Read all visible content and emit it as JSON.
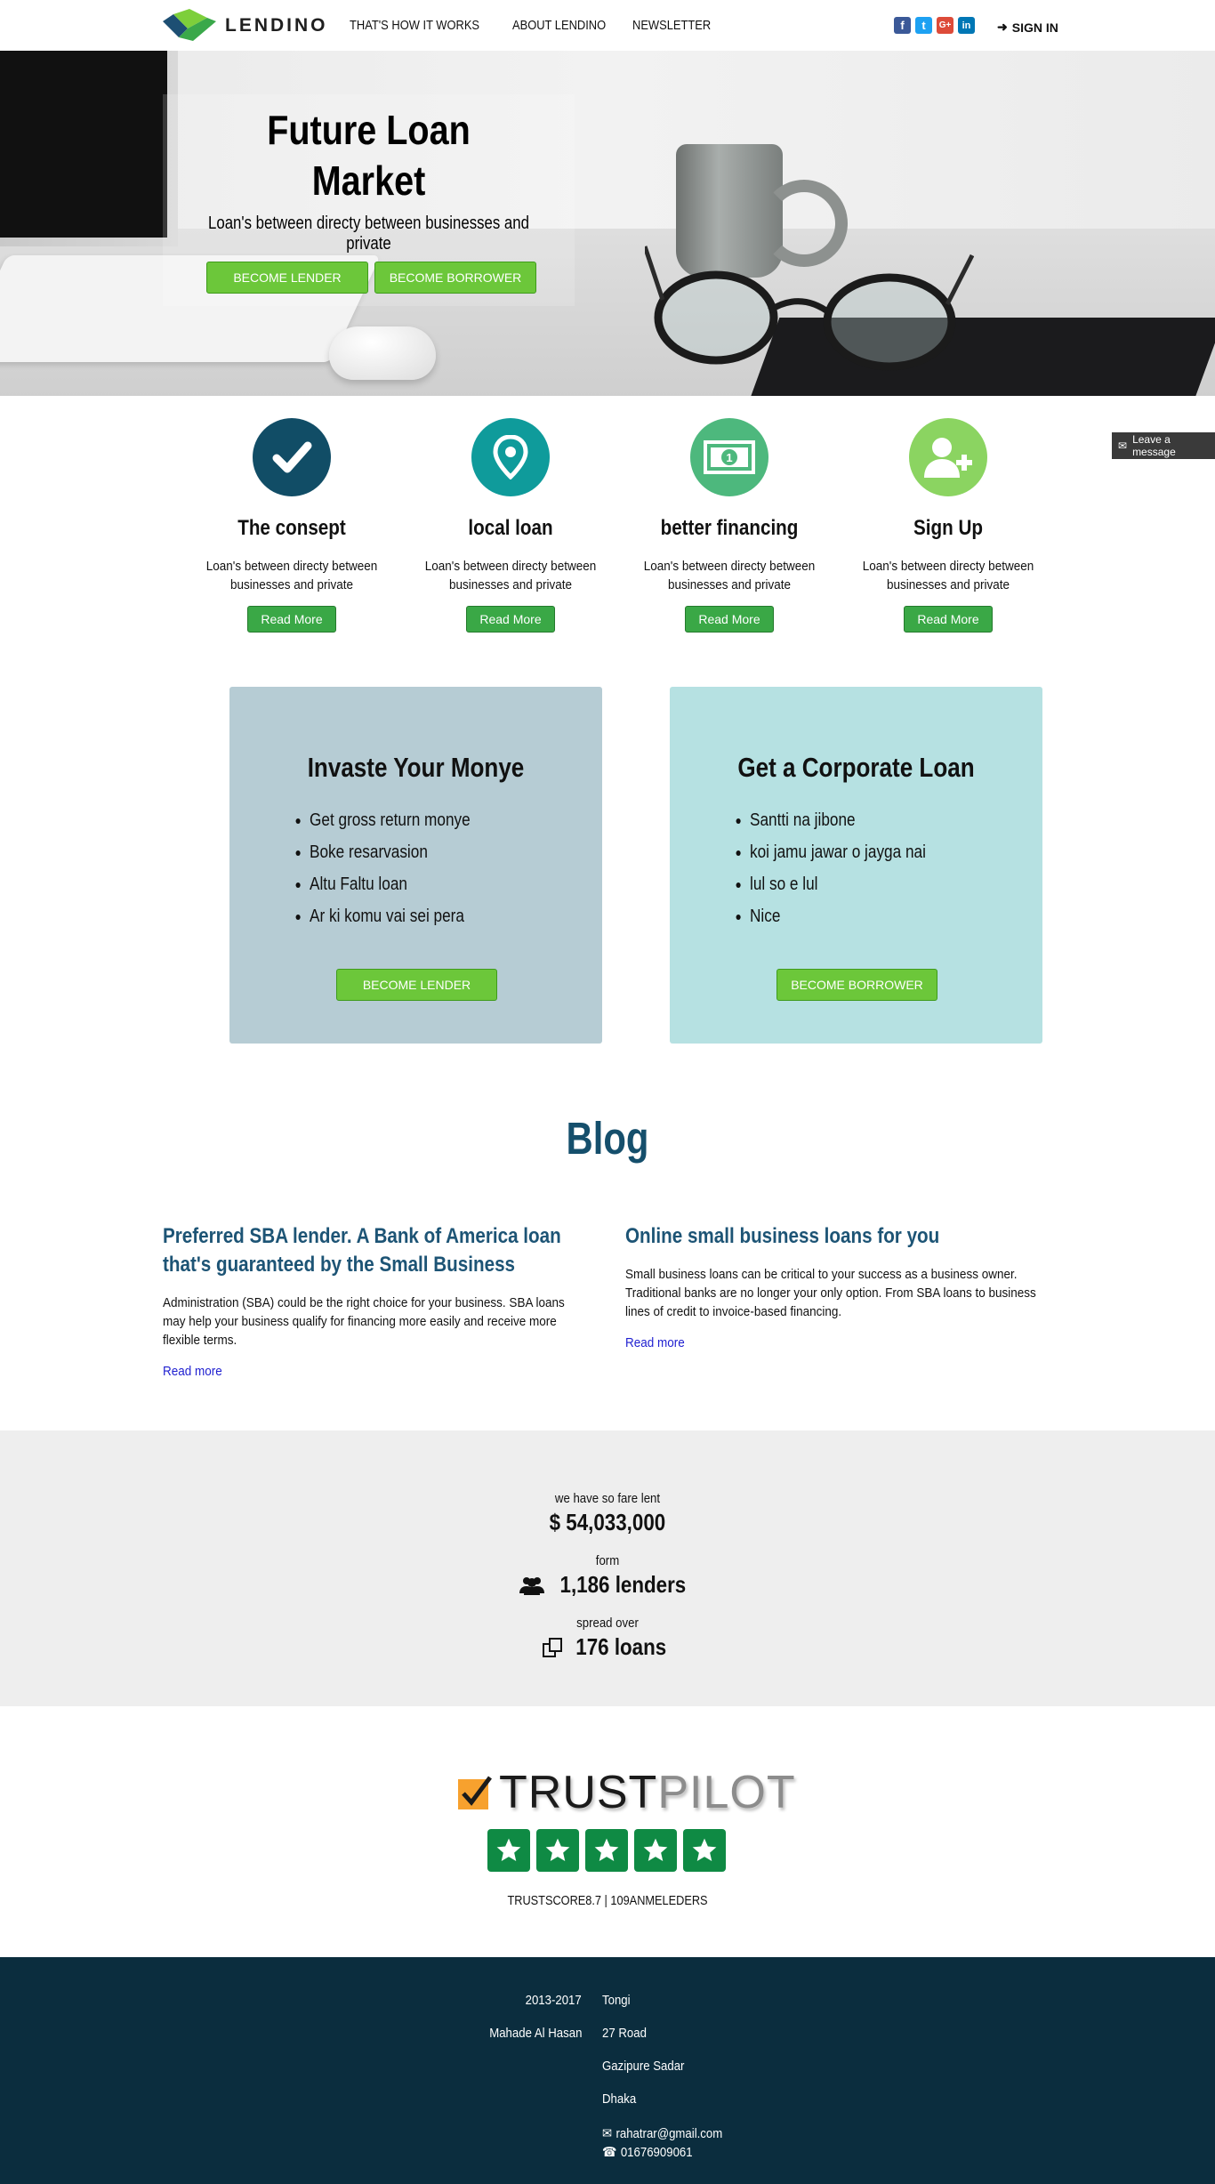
{
  "nav": {
    "logo_text": "LENDINO",
    "links": [
      "THAT'S HOW IT WORKS",
      "ABOUT LENDINO",
      "NEWSLETTER"
    ],
    "socials": [
      {
        "name": "facebook",
        "glyph": "f",
        "color": "#3b5998"
      },
      {
        "name": "twitter",
        "glyph": "t",
        "color": "#1da1f2"
      },
      {
        "name": "google-plus",
        "glyph": "G+",
        "color": "#dd4b39"
      },
      {
        "name": "linkedin",
        "glyph": "in",
        "color": "#0077b5"
      }
    ],
    "signin": "SIGN IN"
  },
  "hero": {
    "title_line1": "Future Loan",
    "title_line2": "Market",
    "subtitle": "Loan's between directy between businesses and private",
    "btn_lender": "BECOME LENDER",
    "btn_borrower": "BECOME BORROWER"
  },
  "features": [
    {
      "icon": "check-icon",
      "color": "#114d66",
      "title": "The consept",
      "desc": "Loan's between directy between businesses and private",
      "button": "Read More"
    },
    {
      "icon": "map-pin-icon",
      "color": "#0f9b9b",
      "title": "local loan",
      "desc": "Loan's between directy between businesses and private",
      "button": "Read More"
    },
    {
      "icon": "money-icon",
      "color": "#4db87d",
      "title": "better financing",
      "desc": "Loan's between directy between businesses and private",
      "button": "Read More"
    },
    {
      "icon": "user-plus-icon",
      "color": "#8bd461",
      "title": "Sign Up",
      "desc": "Loan's between directy between businesses and private",
      "button": "Read More"
    }
  ],
  "offers": [
    {
      "title": "Invaste Your Monye",
      "items": [
        "Get gross return monye",
        "Boke resarvasion",
        "Altu Faltu loan",
        "Ar ki komu vai sei pera"
      ],
      "button": "BECOME LENDER",
      "bg": "#b6ccd4"
    },
    {
      "title": "Get a Corporate Loan",
      "items": [
        "Santti na jibone",
        "koi jamu jawar o jayga nai",
        "lul so e lul",
        "Nice"
      ],
      "button": "BECOME BORROWER",
      "bg": "#b6e1e2"
    }
  ],
  "blog": {
    "heading": "Blog",
    "posts": [
      {
        "title": "Preferred SBA lender. A Bank of America loan that's guaranteed by the Small Business",
        "body": "Administration (SBA) could be the right choice for your business. SBA loans may help your business qualify for financing more easily and receive more flexible terms.",
        "link": "Read more"
      },
      {
        "title": "Online small business loans for you",
        "body": "Small business loans can be critical to your success as a business owner. Traditional banks are no longer your only option. From SBA loans to business lines of credit to invoice-based financing.",
        "link": "Read more"
      }
    ]
  },
  "stats": [
    {
      "label": "we have so fare lent",
      "value": "$ 54,033,000",
      "icon": "dollar-icon"
    },
    {
      "label": "form",
      "value": "1,186 lenders",
      "icon": "users-icon"
    },
    {
      "label": "spread over",
      "value": "176 loans",
      "icon": "copy-icon"
    }
  ],
  "trustpilot": {
    "word_trust": "TRUST",
    "word_pilot": "PILOT",
    "star_count": 5,
    "score": "TRUSTSCORE8.7 | 109ANMELEDERS"
  },
  "footer": {
    "years": "2013-2017",
    "name": "Mahade Al Hasan",
    "address": [
      "Tongi",
      "27 Road",
      "Gazipure Sadar",
      "Dhaka"
    ],
    "email": "rahatrar@gmail.com",
    "phone": "01676909061"
  },
  "leave_message": "Leave a message"
}
